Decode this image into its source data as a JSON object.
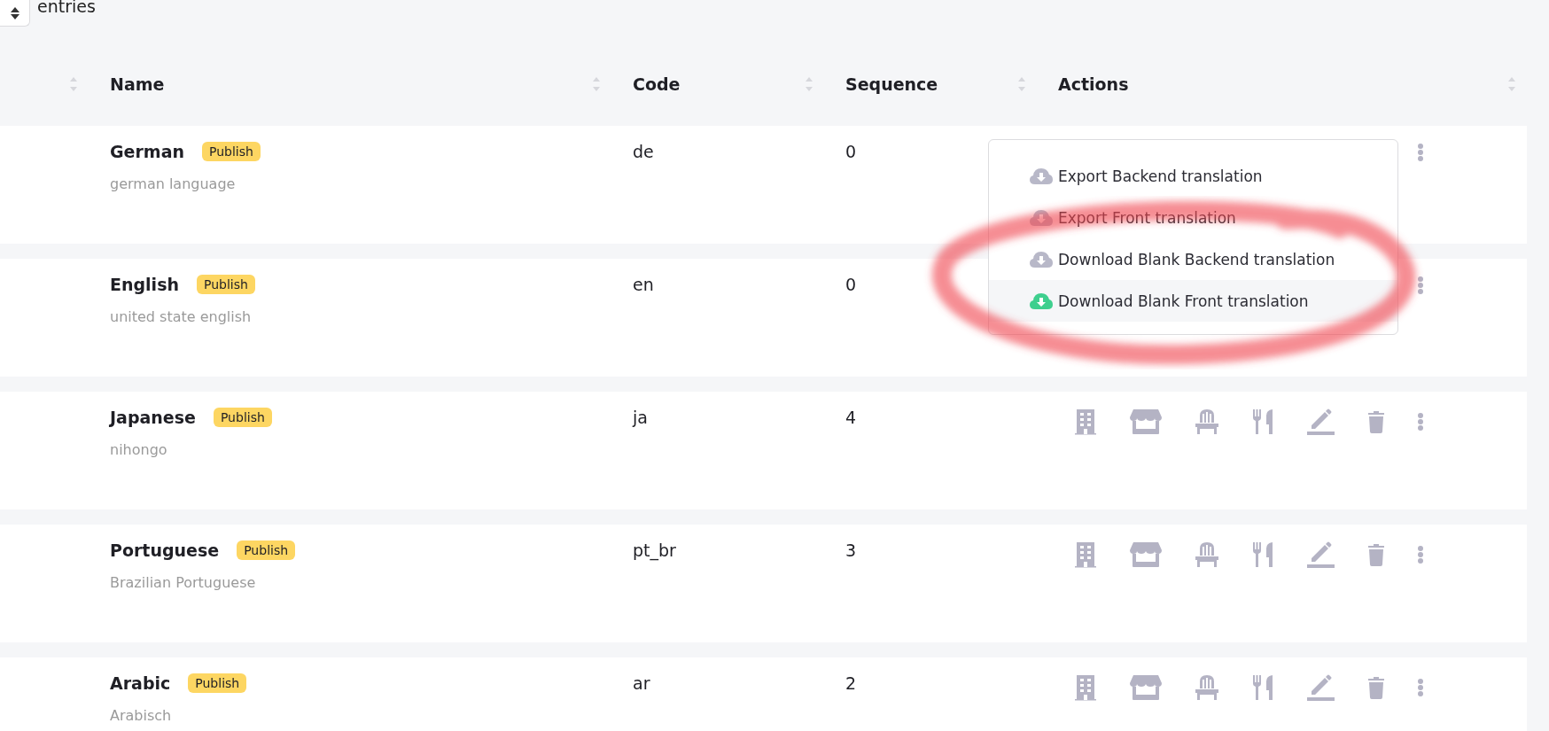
{
  "length_control": {
    "label": "entries"
  },
  "table": {
    "columns": [
      {
        "label": "Name"
      },
      {
        "label": "Code"
      },
      {
        "label": "Sequence"
      },
      {
        "label": "Actions"
      }
    ],
    "rows": [
      {
        "name": "German",
        "badge": "Publish",
        "description": "german language",
        "code": "de",
        "sequence": "0",
        "show_icons": false
      },
      {
        "name": "English",
        "badge": "Publish",
        "description": "united state english",
        "code": "en",
        "sequence": "0",
        "show_icons": false
      },
      {
        "name": "Japanese",
        "badge": "Publish",
        "description": "nihongo",
        "code": "ja",
        "sequence": "4",
        "show_icons": true
      },
      {
        "name": "Portuguese",
        "badge": "Publish",
        "description": "Brazilian Portuguese",
        "code": "pt_br",
        "sequence": "3",
        "show_icons": true
      },
      {
        "name": "Arabic",
        "badge": "Publish",
        "description": "Arabisch",
        "code": "ar",
        "sequence": "2",
        "show_icons": true
      }
    ]
  },
  "actions_menu": {
    "items": [
      {
        "label": "Export Backend translation",
        "selected": false
      },
      {
        "label": "Export Front translation",
        "selected": false
      },
      {
        "label": "Download Blank Backend translation",
        "selected": false
      },
      {
        "label": "Download Blank Front translation",
        "selected": true
      }
    ]
  }
}
